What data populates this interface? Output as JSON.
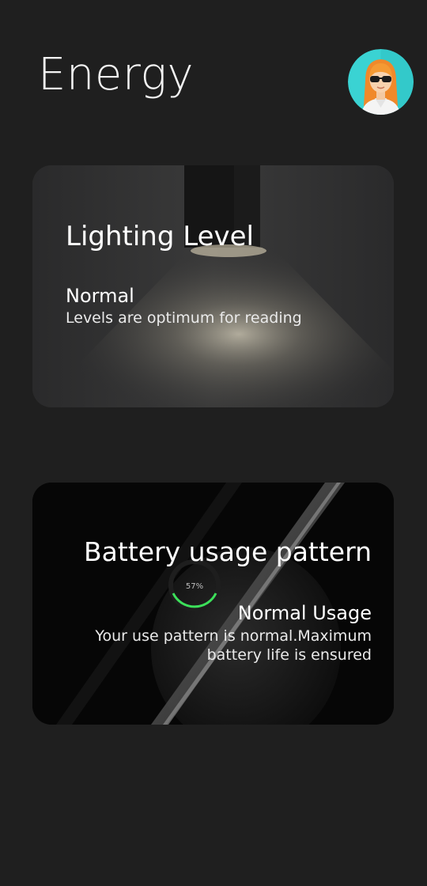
{
  "header": {
    "title": "Energy",
    "avatar_icon": "user-avatar-icon"
  },
  "cards": {
    "lighting": {
      "title": "Lighting Level",
      "status": "Normal",
      "description": "Levels are optimum for reading",
      "background_icon": "wall-lamp-image"
    },
    "battery": {
      "title": "Battery usage pattern",
      "status": "Normal Usage",
      "description": "Your use pattern is normal.Maximum battery life is ensured",
      "background_icon": "wireless-charger-image",
      "charge_display": "57%"
    }
  },
  "colors": {
    "background": "#1f1f1f",
    "avatar_circle": "#3ad3d3",
    "charge_ring": "#3ce05a"
  }
}
